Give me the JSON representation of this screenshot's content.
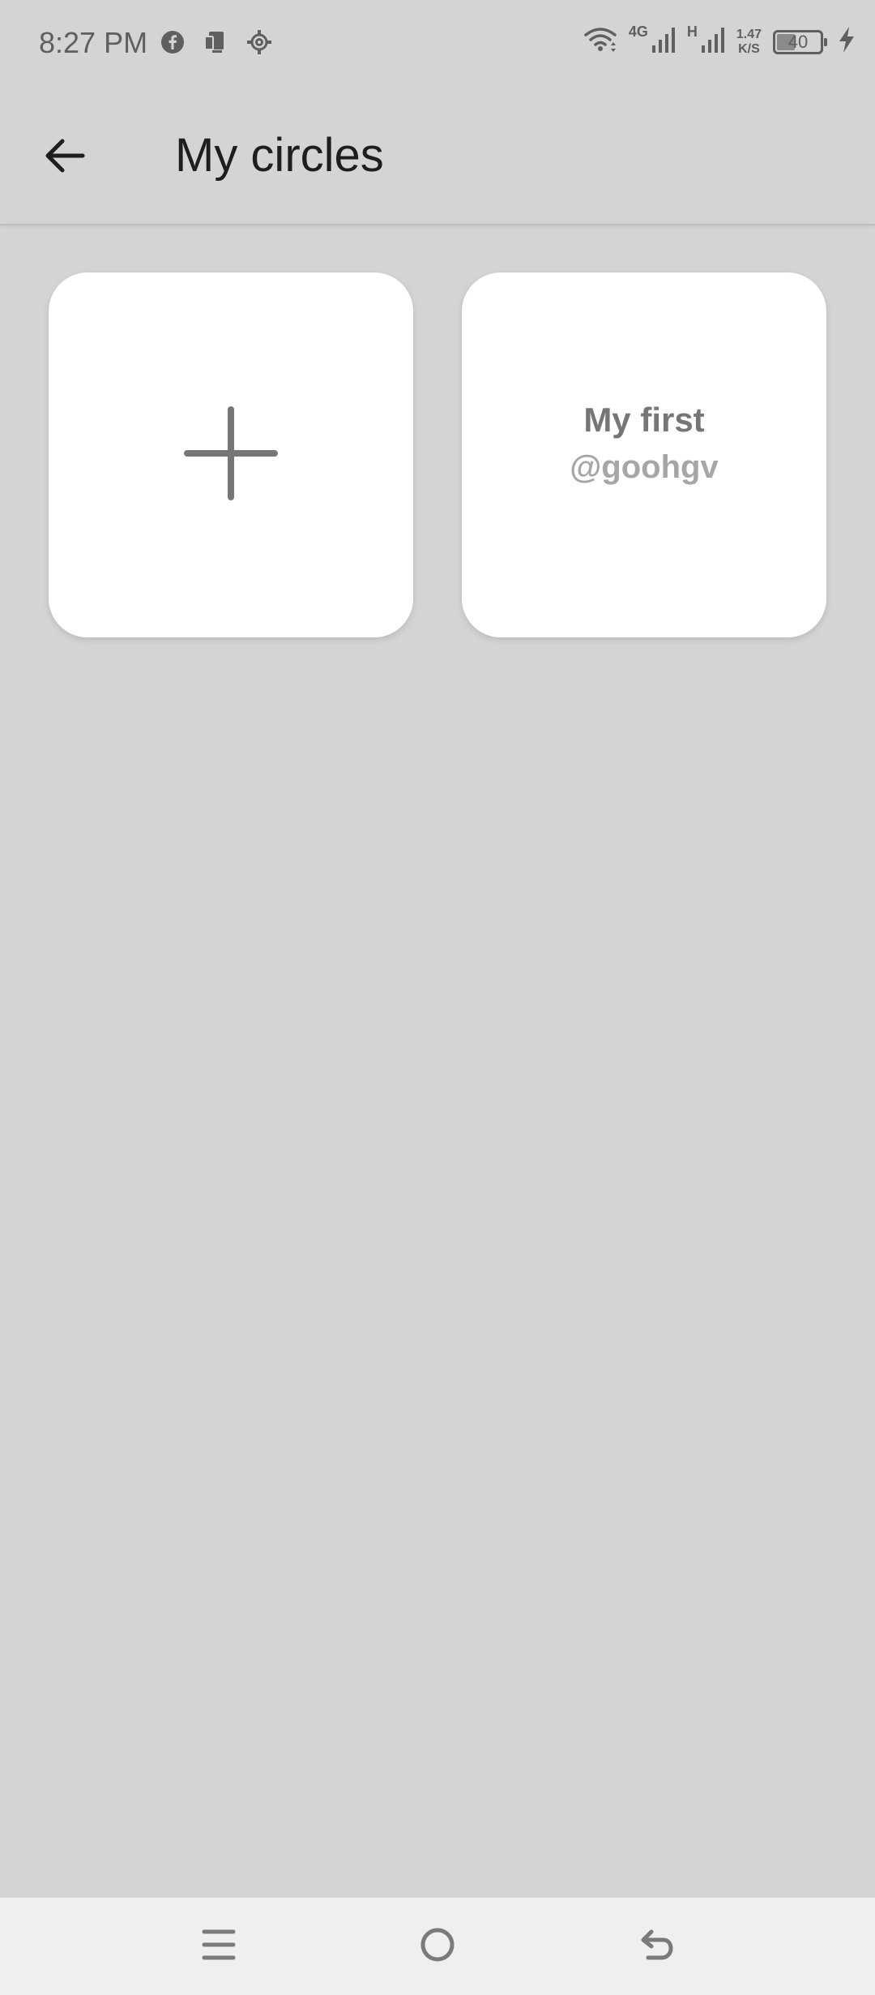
{
  "status_bar": {
    "time": "8:27 PM",
    "network_4g": "4G",
    "network_h": "H",
    "speed_value": "1.47",
    "speed_unit": "K/S",
    "battery": "40",
    "left_icons": [
      "facebook-icon",
      "screen-mirror-icon",
      "settings-gear-icon"
    ],
    "right_icons": [
      "wifi-icon",
      "signal-icon",
      "signal-icon",
      "battery-icon",
      "charging-bolt-icon"
    ]
  },
  "app_bar": {
    "title": "My circles",
    "back_icon": "arrow-left-icon"
  },
  "circles": {
    "add_card_icon": "plus-icon",
    "items": [
      {
        "name": "My first",
        "handle": "@goohgv"
      }
    ]
  },
  "nav_bar": {
    "icons": [
      "menu-icon",
      "home-circle-icon",
      "back-return-icon"
    ]
  },
  "colors": {
    "background": "#d4d4d4",
    "card": "#ffffff",
    "nav_bar": "#efefef",
    "title_text": "#1e1e1e",
    "icon_gray": "#767676"
  }
}
